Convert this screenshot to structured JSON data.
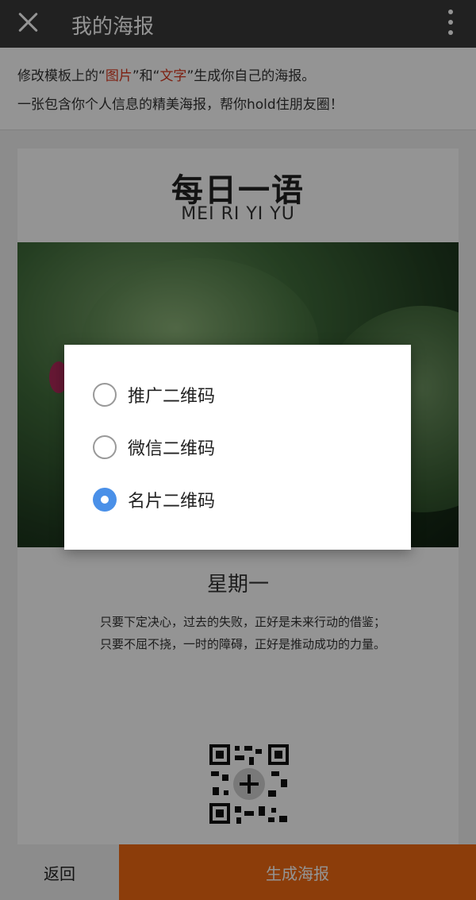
{
  "topbar": {
    "title": "我的海报"
  },
  "instructions": {
    "line1_a": "修改模板上的“",
    "line1_img": "图片",
    "line1_b": "”和“",
    "line1_text": "文字",
    "line1_c": "”生成你自己的海报。",
    "line2": "一张包含你个人信息的精美海报，帮你hold住朋友圈！"
  },
  "poster": {
    "title": "每日一语",
    "subtitle": "MEI RI YI YU",
    "weekday": "星期一",
    "quote": "只要下定决心，过去的失败，正好是未来行动的借鉴；只要不屈不挠，一时的障碍，正好是推动成功的力量。"
  },
  "dialog": {
    "options": [
      {
        "label": "推广二维码",
        "selected": false
      },
      {
        "label": "微信二维码",
        "selected": false
      },
      {
        "label": "名片二维码",
        "selected": true
      }
    ]
  },
  "bottom": {
    "back_label": "返回",
    "generate_label": "生成海报"
  },
  "colors": {
    "accent": "#f26a12",
    "highlight": "#d9381e",
    "radio_on": "#4a90e8",
    "topbar": "#3a3a3a"
  }
}
